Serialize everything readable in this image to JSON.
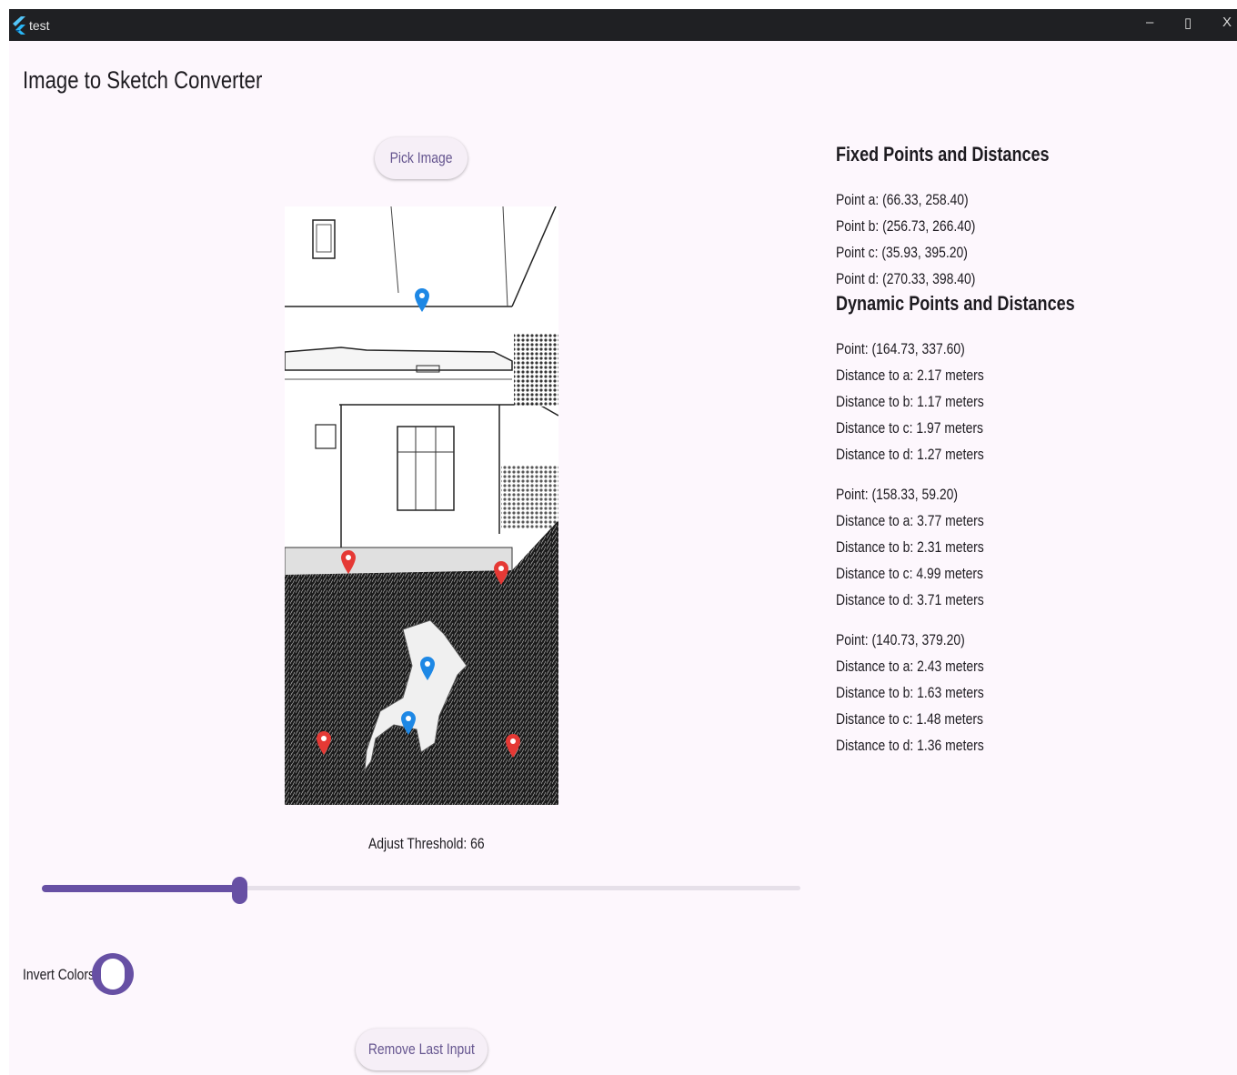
{
  "window": {
    "title": "test",
    "minimize": "–",
    "maximize": "▯",
    "close": "X"
  },
  "app_title": "Image to Sketch Converter",
  "pick_button": "Pick Image",
  "threshold": {
    "label": "Adjust Threshold: 66",
    "value": 66,
    "min": 0,
    "max": 255
  },
  "invert": {
    "label": "Invert Colors",
    "on": true
  },
  "remove_button": "Remove Last Input",
  "fixed": {
    "title": "Fixed Points and Distances",
    "points": [
      "Point a: (66.33, 258.40)",
      "Point b: (256.73, 266.40)",
      "Point c: (35.93, 395.20)",
      "Point d: (270.33, 398.40)"
    ]
  },
  "dynamic": {
    "title": "Dynamic Points and Distances",
    "groups": [
      {
        "point": "Point: (164.73, 337.60)",
        "distances": [
          "Distance to a: 2.17 meters",
          "Distance to b: 1.17 meters",
          "Distance to c: 1.97 meters",
          "Distance to d: 1.27 meters"
        ]
      },
      {
        "point": "Point: (158.33, 59.20)",
        "distances": [
          "Distance to a: 3.77 meters",
          "Distance to b: 2.31 meters",
          "Distance to c: 4.99 meters",
          "Distance to d: 3.71 meters"
        ]
      },
      {
        "point": "Point: (140.73, 379.20)",
        "distances": [
          "Distance to a: 2.43 meters",
          "Distance to b: 1.63 meters",
          "Distance to c: 1.48 meters",
          "Distance to d: 1.36 meters"
        ]
      }
    ]
  },
  "colors": {
    "accent": "#6750a4",
    "fixed_pin": "#e53935",
    "dynamic_pin": "#1e88e5"
  }
}
